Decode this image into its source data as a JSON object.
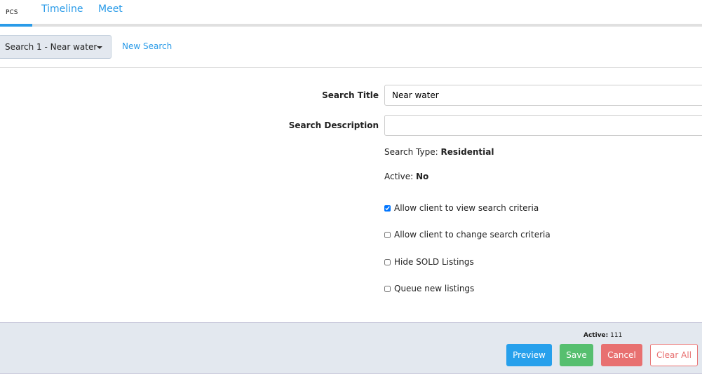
{
  "tabs": [
    {
      "label": "PCS"
    },
    {
      "label": "Timeline"
    },
    {
      "label": "Meet"
    }
  ],
  "search_dropdown": {
    "label": "Search 1 - Near water"
  },
  "new_search": "New Search",
  "form": {
    "title_label": "Search Title",
    "title_value": "Near water",
    "description_label": "Search Description",
    "description_value": "",
    "type_label": "Search Type:",
    "type_value": "Residential",
    "active_label": "Active:",
    "active_value": "No",
    "checkboxes": [
      {
        "label": "Allow client to view search criteria",
        "checked": true
      },
      {
        "label": "Allow client to change search criteria",
        "checked": false
      },
      {
        "label": "Hide SOLD Listings",
        "checked": false
      },
      {
        "label": "Queue new listings",
        "checked": false
      }
    ]
  },
  "footer": {
    "active_label": "Active:",
    "active_count": "111",
    "preview": "Preview",
    "save": "Save",
    "cancel": "Cancel",
    "clear_all": "Clear All"
  },
  "colors": {
    "primary": "#27a0ec",
    "success": "#56bf6f",
    "danger": "#e87070"
  }
}
